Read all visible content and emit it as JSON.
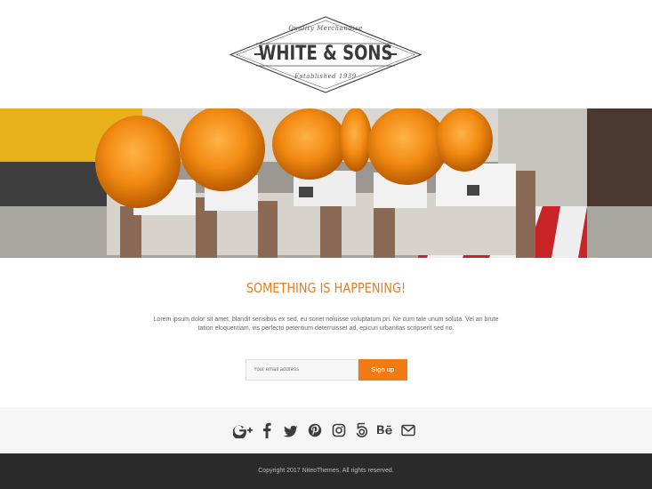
{
  "logo": {
    "tagline": "Quality Merchandise",
    "name": "WHITE & SONS",
    "established": "Established 1939"
  },
  "hero": {
    "image": "construction-warning-lights-photo"
  },
  "main": {
    "headline": "SOMETHING IS HAPPENING!",
    "body": "Lorem ipsum dolor sit amet, blandit sensibus ex sed, eu sonet noluisse voluptatum pri. Ne cum tale unum soluta. Vel an brute tation eloquentiam, vis perfecto petentium deterruisset ad, epicuri urbanitas scripserit sed no."
  },
  "signup": {
    "placeholder": "Your email address",
    "value": "",
    "button_label": "Sign up"
  },
  "social": {
    "icons": [
      "google-plus-icon",
      "facebook-icon",
      "twitter-icon",
      "pinterest-icon",
      "instagram-icon",
      "500px-icon",
      "behance-icon",
      "email-icon"
    ]
  },
  "footer": {
    "copyright": "Copyright 2017 NiteoThemes. All rights reserved."
  },
  "colors": {
    "accent": "#f27a13",
    "headline": "#ef7a1a",
    "footer_bg": "#2b2a2a",
    "social_band_bg": "#f5f5f5",
    "icon": "#3b3b3b"
  }
}
